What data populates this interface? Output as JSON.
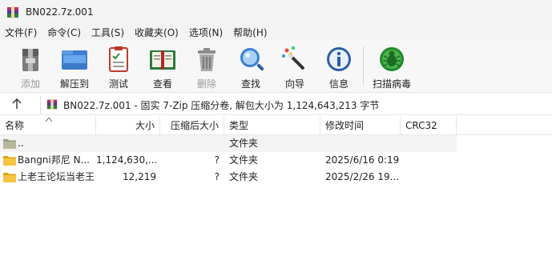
{
  "window": {
    "title": "BN022.7z.001"
  },
  "menu": [
    "文件(F)",
    "命令(C)",
    "工具(S)",
    "收藏夹(O)",
    "选项(N)",
    "帮助(H)"
  ],
  "toolbar": [
    {
      "label": "添加",
      "icon": "add-icon",
      "disabled": true
    },
    {
      "label": "解压到",
      "icon": "extract-to-icon"
    },
    {
      "label": "测试",
      "icon": "test-icon"
    },
    {
      "label": "查看",
      "icon": "view-book-icon"
    },
    {
      "label": "删除",
      "icon": "trash-icon",
      "disabled": true
    },
    {
      "label": "查找",
      "icon": "magnifier-icon"
    },
    {
      "label": "向导",
      "icon": "wizard-wand-icon"
    },
    {
      "label": "信息",
      "icon": "info-icon"
    },
    {
      "label": "扫描病毒",
      "icon": "virus-scan-icon"
    }
  ],
  "address": {
    "text": "BN022.7z.001 - 固实 7-Zip 压缩分卷, 解包大小为 1,124,643,213 字节"
  },
  "columns": {
    "name": "名称",
    "size": "大小",
    "packed": "压缩后大小",
    "type": "类型",
    "modified": "修改时间",
    "crc": "CRC32"
  },
  "rows": [
    {
      "name": "..",
      "size": "",
      "packed": "",
      "type": "文件夹",
      "modified": ""
    },
    {
      "name": "Bangni邦尼 N...",
      "size": "1,124,630,...",
      "packed": "?",
      "type": "文件夹",
      "modified": "2025/6/16 0:19"
    },
    {
      "name": "上老王论坛当老王",
      "size": "12,219",
      "packed": "?",
      "type": "文件夹",
      "modified": "2025/2/26 19..."
    }
  ],
  "colors": {
    "folder": "#f5c542",
    "folder_dark": "#d9a514",
    "titlebar_bg": "#f3f3f3",
    "selected_row": "#f3f3f3"
  }
}
